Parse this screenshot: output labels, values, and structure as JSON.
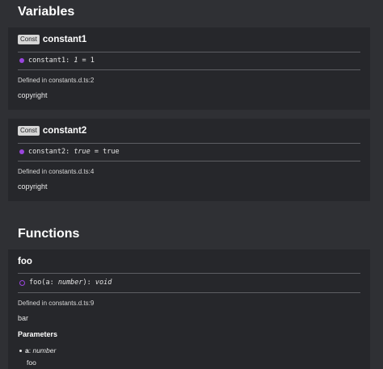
{
  "variables": {
    "title": "Variables",
    "items": [
      {
        "badge": "Const",
        "name": "constant1",
        "sig_name": "constant1",
        "sig_sep": ": ",
        "sig_type": "1",
        "sig_eq": " = ",
        "sig_value": "1",
        "defined": "Defined in constants.d.ts:2",
        "comment": "copyright"
      },
      {
        "badge": "Const",
        "name": "constant2",
        "sig_name": "constant2",
        "sig_sep": ": ",
        "sig_type": "true",
        "sig_eq": " = ",
        "sig_value": "true",
        "defined": "Defined in constants.d.ts:4",
        "comment": "copyright"
      }
    ]
  },
  "functions": {
    "title": "Functions",
    "items": [
      {
        "name": "foo",
        "sig_prefix": "foo(a: ",
        "sig_param_type": "number",
        "sig_close": "): ",
        "sig_return": "void",
        "defined": "Defined in constants.d.ts:9",
        "comment": "bar",
        "params_title": "Parameters",
        "param_name": "a",
        "param_sep": ": ",
        "param_type": "number",
        "param_comment": "foo"
      }
    ]
  },
  "colors": {
    "background": "#2f3034",
    "card": "#26272b",
    "accent_purple": "#9a45de"
  },
  "icons": [
    "const-dot-icon",
    "function-ring-icon",
    "bullet-icon"
  ]
}
